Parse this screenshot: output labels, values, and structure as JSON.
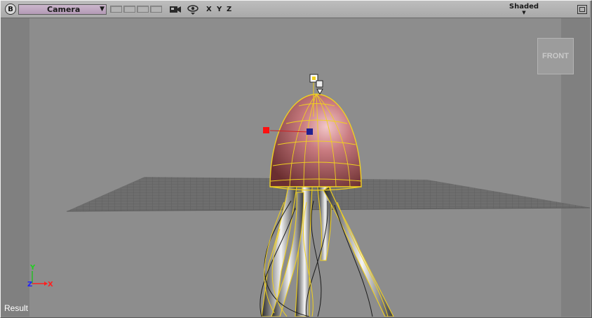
{
  "toolbar": {
    "menu_button_label": "B",
    "camera_select": "Camera",
    "axis_labels": [
      "X",
      "Y",
      "Z"
    ],
    "display_mode": "Shaded"
  },
  "viewport": {
    "nav_cube_label": "FRONT",
    "axis_triad": {
      "y": "Y",
      "z": "Z",
      "x": "X"
    },
    "status_label": "Result"
  },
  "colors": {
    "axis_x": "#ff2020",
    "axis_y": "#20c020",
    "axis_z": "#2020ff",
    "wire": "#f0d020",
    "dome": "#c06a6e"
  }
}
